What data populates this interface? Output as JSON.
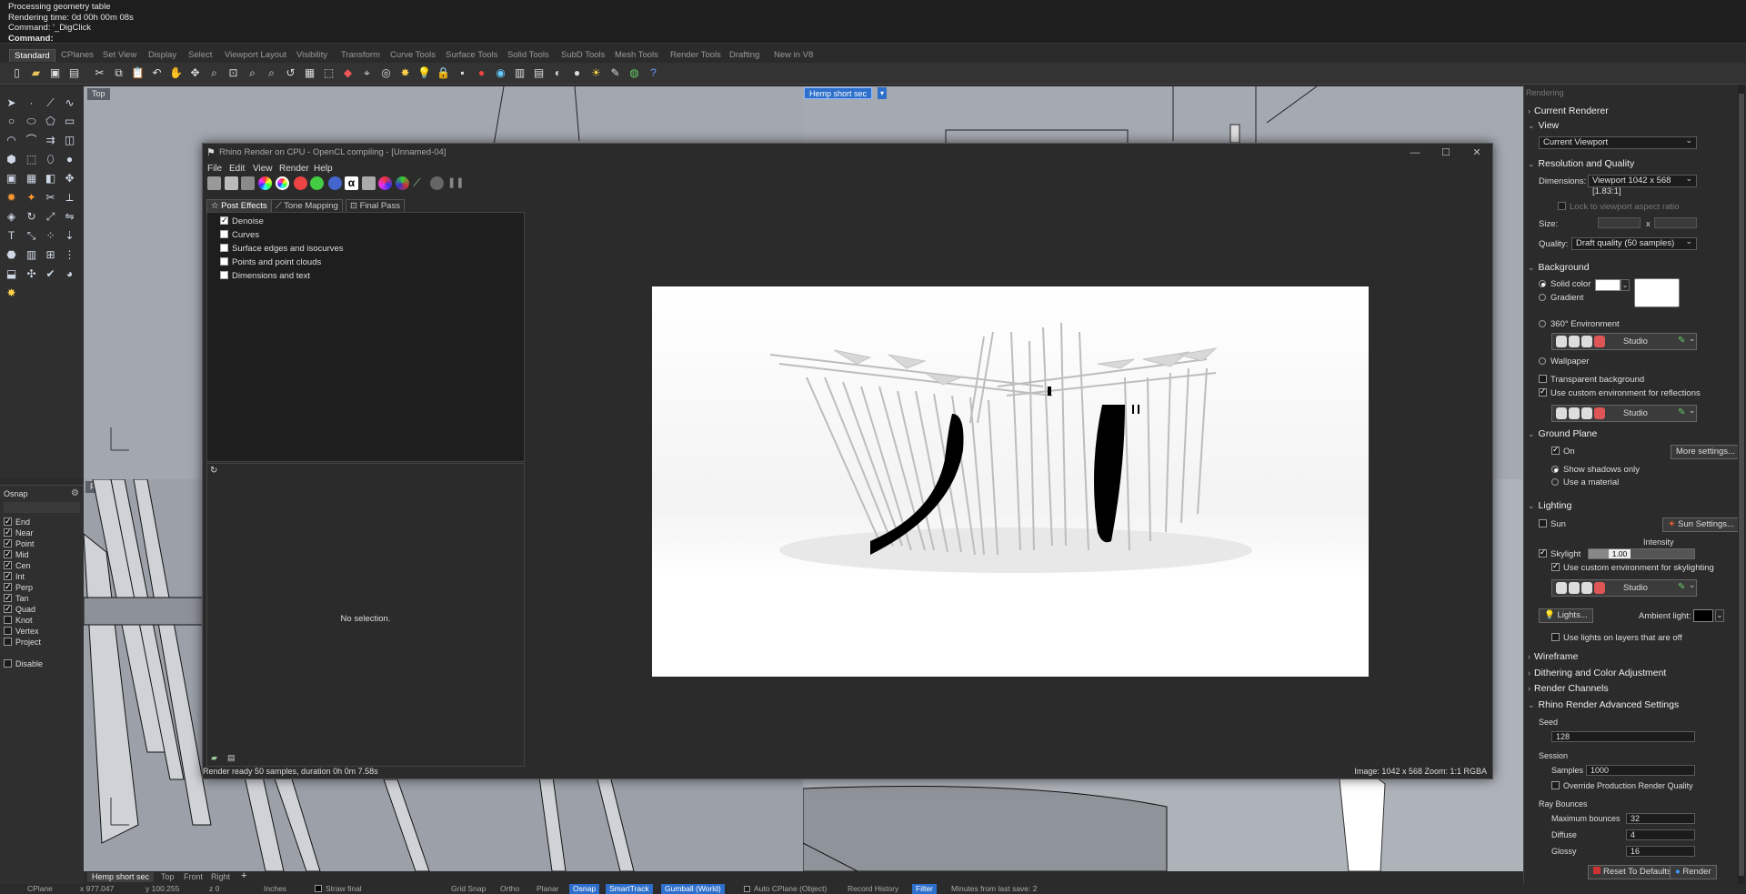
{
  "command": {
    "history": [
      "Processing geometry table",
      "Rendering time: 0d 00h 00m 08s",
      "Command: '_DigClick"
    ],
    "prompt": "Command:"
  },
  "tabs": [
    "Standard",
    "CPlanes",
    "Set View",
    "Display",
    "Select",
    "Viewport Layout",
    "Visibility",
    "Transform",
    "Curve Tools",
    "Surface Tools",
    "Solid Tools",
    "SubD Tools",
    "Mesh Tools",
    "Render Tools",
    "Drafting",
    "New in V8"
  ],
  "viewports": {
    "top": "Top",
    "active": "Hemp short sec",
    "front": "Front"
  },
  "osnap": {
    "title": "Osnap",
    "items": [
      {
        "label": "End",
        "checked": true
      },
      {
        "label": "Near",
        "checked": true
      },
      {
        "label": "Point",
        "checked": true
      },
      {
        "label": "Mid",
        "checked": true
      },
      {
        "label": "Cen",
        "checked": true
      },
      {
        "label": "Int",
        "checked": true
      },
      {
        "label": "Perp",
        "checked": true
      },
      {
        "label": "Tan",
        "checked": true
      },
      {
        "label": "Quad",
        "checked": true
      },
      {
        "label": "Knot",
        "checked": false
      },
      {
        "label": "Vertex",
        "checked": false
      },
      {
        "label": "Project",
        "checked": false
      }
    ],
    "disable": "Disable"
  },
  "render_window": {
    "title": "Rhino Render on CPU - OpenCL compiling - [Unnamed-04]",
    "menu": [
      "File",
      "Edit",
      "View",
      "Render",
      "Help"
    ],
    "tabs": [
      "Post Effects",
      "Tone Mapping",
      "Final Pass"
    ],
    "post_effects": [
      {
        "label": "Denoise",
        "checked": true
      },
      {
        "label": "Curves",
        "checked": false
      },
      {
        "label": "Surface edges and isocurves",
        "checked": false
      },
      {
        "label": "Points and point clouds",
        "checked": false
      },
      {
        "label": "Dimensions and text",
        "checked": false
      }
    ],
    "no_selection": "No selection.",
    "status_left": "Render ready 50 samples, duration 0h 0m 7.58s",
    "status_right": "Image: 1042 x 568  Zoom: 1:1  RGBA"
  },
  "rendering_panel": {
    "title": "Rendering",
    "current_renderer": "Current Renderer",
    "view_section": "View",
    "view_value": "Current Viewport",
    "res_section": "Resolution and Quality",
    "dimensions_label": "Dimensions:",
    "dimensions_value": "Viewport 1042 x 568 [1.83:1]",
    "lock_aspect": "Lock to viewport aspect ratio",
    "size_label": "Size:",
    "size_x": "x",
    "quality_label": "Quality:",
    "quality_value": "Draft quality (50 samples)",
    "background": "Background",
    "solid_color": "Solid color",
    "gradient": "Gradient",
    "env360": "360° Environment",
    "studio": "Studio",
    "wallpaper": "Wallpaper",
    "transparent_bg": "Transparent background",
    "custom_env_reflections": "Use custom environment for reflections",
    "ground_plane": "Ground Plane",
    "on": "On",
    "more_settings": "More settings...",
    "shadows_only": "Show shadows only",
    "use_material": "Use a material",
    "lighting": "Lighting",
    "sun": "Sun",
    "sun_settings": "Sun Settings...",
    "intensity": "Intensity",
    "skylight": "Skylight",
    "skylight_value": "1.00",
    "custom_env_sky": "Use custom environment for skylighting",
    "lights_btn": "Lights...",
    "ambient": "Ambient light:",
    "lights_off_layers": "Use lights on layers that are off",
    "wireframe": "Wireframe",
    "dithering": "Dithering and Color Adjustment",
    "render_channels": "Render Channels",
    "advanced": "Rhino Render Advanced Settings",
    "seed": "Seed",
    "seed_value": "128",
    "session": "Session",
    "samples_label": "Samples",
    "samples_value": "1000",
    "override_quality": "Override Production Render Quality",
    "ray_bounces": "Ray Bounces",
    "max_bounces": "Maximum bounces",
    "max_bounces_value": "32",
    "diffuse": "Diffuse",
    "diffuse_value": "4",
    "glossy": "Glossy",
    "glossy_value": "16",
    "reset": "Reset To Defaults",
    "render": "Render"
  },
  "viewport_tabs": [
    "Hemp short sec",
    "Top",
    "Front",
    "Right",
    "+"
  ],
  "status_bar": [
    "CPlane",
    "x 977.047",
    "y 100.255",
    "z 0",
    "Inches",
    "Straw final",
    "Grid Snap",
    "Ortho",
    "Planar",
    "Osnap",
    "SmartTrack",
    "Gumball (World)",
    "Auto CPlane (Object)",
    "Record History",
    "Filter",
    "Minutes from last save: 2"
  ]
}
